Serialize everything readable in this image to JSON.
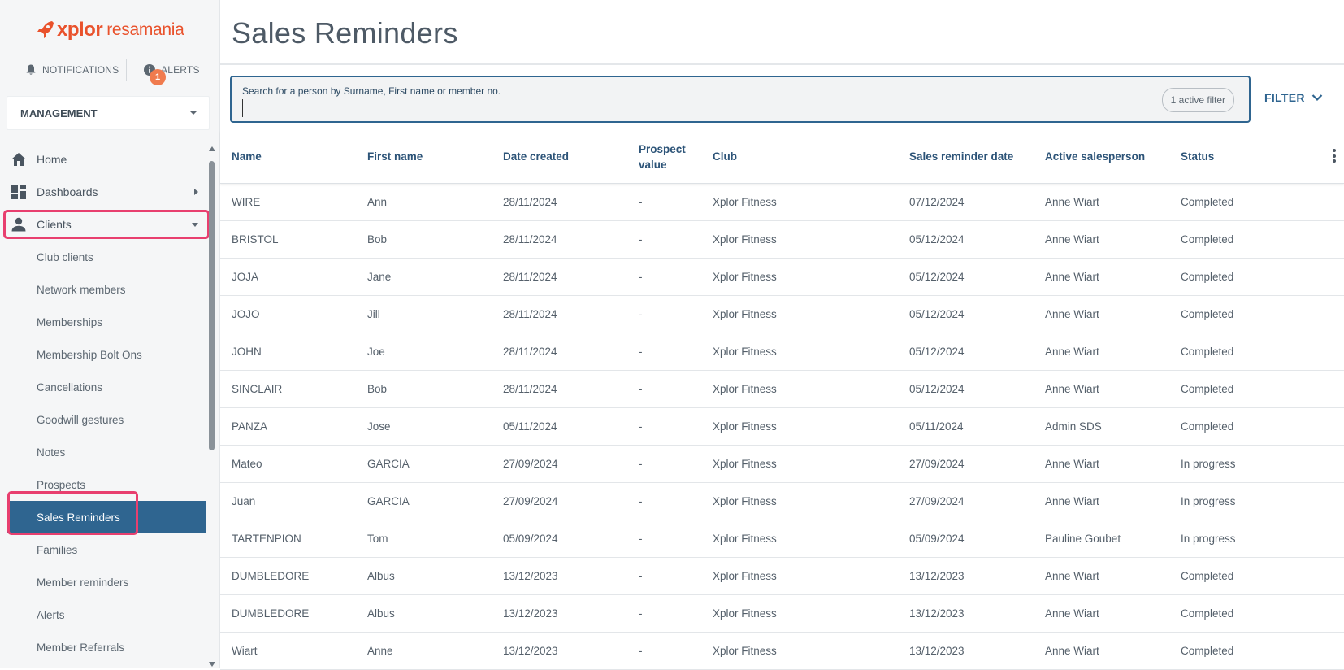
{
  "brand": {
    "x": "xplor",
    "name": "resamania",
    "color": "#e9522c"
  },
  "topbar": {
    "notifications": "NOTIFICATIONS",
    "alerts": "ALERTS",
    "alerts_count": "1"
  },
  "workspace": {
    "selected": "MANAGEMENT"
  },
  "nav": {
    "home": "Home",
    "dashboards": "Dashboards",
    "clients": "Clients",
    "sub": [
      "Club clients",
      "Network members",
      "Memberships",
      "Membership Bolt Ons",
      "Cancellations",
      "Goodwill gestures",
      "Notes",
      "Prospects",
      "Sales Reminders",
      "Families",
      "Member reminders",
      "Alerts",
      "Member Referrals"
    ],
    "active_index": 8
  },
  "page": {
    "title": "Sales Reminders"
  },
  "search": {
    "label": "Search for a person by Surname, First name or member no.",
    "value": "",
    "filter_chip": "1 active filter",
    "filter_button": "FILTER"
  },
  "table": {
    "headers": [
      "Name",
      "First name",
      "Date created",
      "Prospect value",
      "Club",
      "Sales reminder date",
      "Active salesperson",
      "Status"
    ],
    "rows": [
      [
        "WIRE",
        "Ann",
        "28/11/2024",
        "-",
        "Xplor Fitness",
        "07/12/2024",
        "Anne Wiart",
        "Completed"
      ],
      [
        "BRISTOL",
        "Bob",
        "28/11/2024",
        "-",
        "Xplor Fitness",
        "05/12/2024",
        "Anne Wiart",
        "Completed"
      ],
      [
        "JOJA",
        "Jane",
        "28/11/2024",
        "-",
        "Xplor Fitness",
        "05/12/2024",
        "Anne Wiart",
        "Completed"
      ],
      [
        "JOJO",
        "Jill",
        "28/11/2024",
        "-",
        "Xplor Fitness",
        "05/12/2024",
        "Anne Wiart",
        "Completed"
      ],
      [
        "JOHN",
        "Joe",
        "28/11/2024",
        "-",
        "Xplor Fitness",
        "05/12/2024",
        "Anne Wiart",
        "Completed"
      ],
      [
        "SINCLAIR",
        "Bob",
        "28/11/2024",
        "-",
        "Xplor Fitness",
        "05/12/2024",
        "Anne Wiart",
        "Completed"
      ],
      [
        "PANZA",
        "Jose",
        "05/11/2024",
        "-",
        "Xplor Fitness",
        "05/11/2024",
        "Admin SDS",
        "Completed"
      ],
      [
        "Mateo",
        "GARCIA",
        "27/09/2024",
        "-",
        "Xplor Fitness",
        "27/09/2024",
        "Anne Wiart",
        "In progress"
      ],
      [
        "Juan",
        "GARCIA",
        "27/09/2024",
        "-",
        "Xplor Fitness",
        "27/09/2024",
        "Anne Wiart",
        "In progress"
      ],
      [
        "TARTENPION",
        "Tom",
        "05/09/2024",
        "-",
        "Xplor Fitness",
        "05/09/2024",
        "Pauline Goubet",
        "In progress"
      ],
      [
        "DUMBLEDORE",
        "Albus",
        "13/12/2023",
        "-",
        "Xplor Fitness",
        "13/12/2023",
        "Anne Wiart",
        "Completed"
      ],
      [
        "DUMBLEDORE",
        "Albus",
        "13/12/2023",
        "-",
        "Xplor Fitness",
        "13/12/2023",
        "Anne Wiart",
        "Completed"
      ],
      [
        "Wiart",
        "Anne",
        "13/12/2023",
        "-",
        "Xplor Fitness",
        "13/12/2023",
        "Anne Wiart",
        "Completed"
      ]
    ]
  },
  "colors": {
    "accent": "#2f6590",
    "highlight": "#e83f6f",
    "badge": "#f07b4e"
  }
}
